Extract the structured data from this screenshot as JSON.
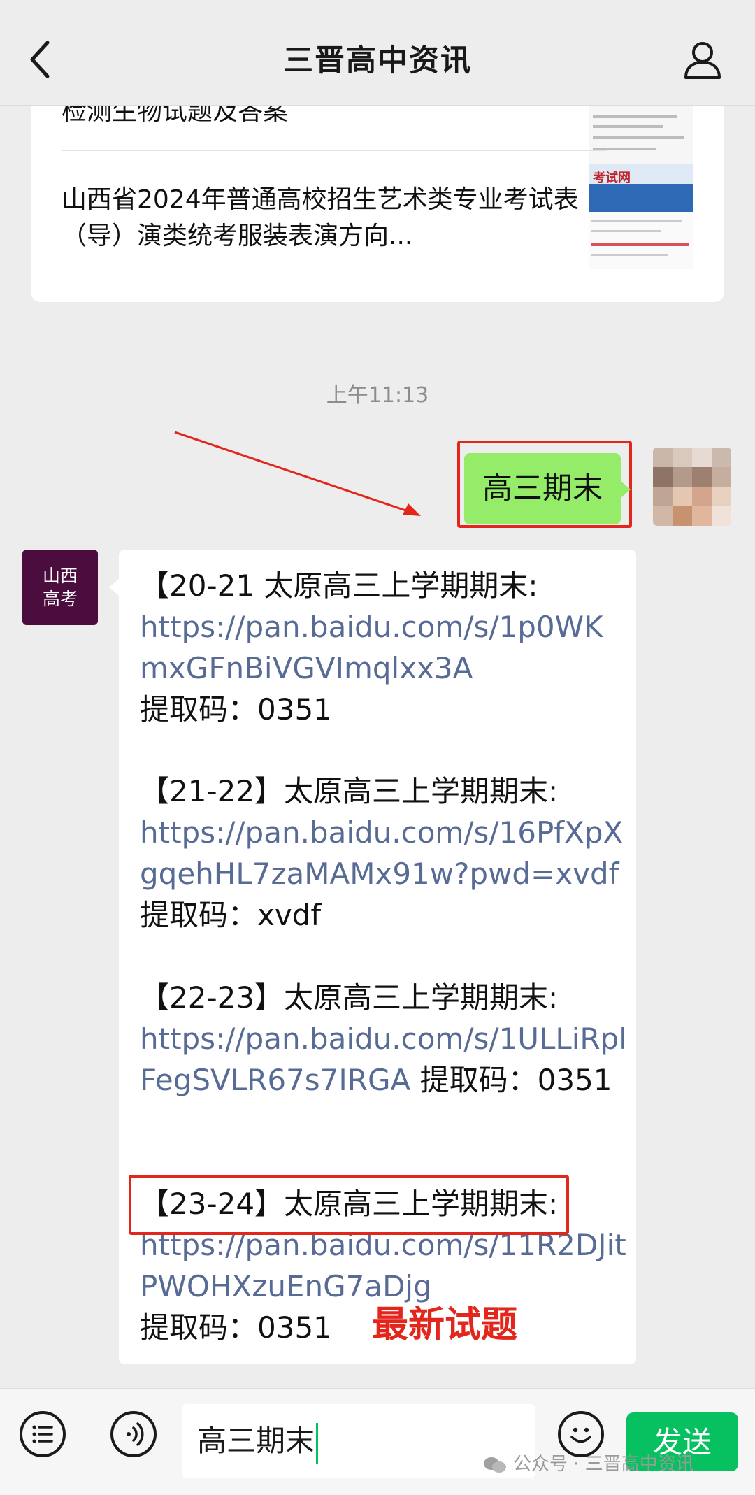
{
  "header": {
    "title": "三晋高中资讯"
  },
  "article_card": {
    "item1_title": "检测生物试题及答案",
    "item2_title": "山西省2024年普通高校招生艺术类专业考试表（导）演类统考服装表演方向...",
    "thumb2_text": "考试网"
  },
  "chat": {
    "timestamp": "上午11:13",
    "sent_message": "高三期末",
    "bot_avatar_text": [
      "山西",
      "高考"
    ],
    "reply": [
      {
        "heading": "【20-21 太原高三上学期期末:",
        "link": "https://pan.baidu.com/s/1p0WKmxGFnBiVGVImqlxx3A",
        "code_label": "提取码：0351"
      },
      {
        "heading": "【21-22】太原高三上学期期末:",
        "link": "https://pan.baidu.com/s/16PfXpXgqehHL7zaMAMx91w?pwd=xvdf",
        "code_label": "提取码：xvdf"
      },
      {
        "heading": "【22-23】太原高三上学期期末:",
        "link": "https://pan.baidu.com/s/1ULLiRplFegSVLR67s7IRGA",
        "code_label": "提取码：0351"
      },
      {
        "heading": "【23-24】太原高三上学期期末:",
        "link": "https://pan.baidu.com/s/11R2DJitPWOHXzuEnG7aDjg",
        "code_label": "提取码：0351"
      }
    ],
    "annotation_note": "最新试题"
  },
  "input_bar": {
    "input_value": "高三期末",
    "send_label": "发送"
  },
  "watermark": "公众号 · 三晋高中资讯",
  "colors": {
    "accent_green": "#07c160",
    "bubble_green": "#95ec69",
    "link_blue": "#576b95",
    "annotation_red": "#e3261c",
    "bot_avatar_bg": "#4a0d3d"
  }
}
